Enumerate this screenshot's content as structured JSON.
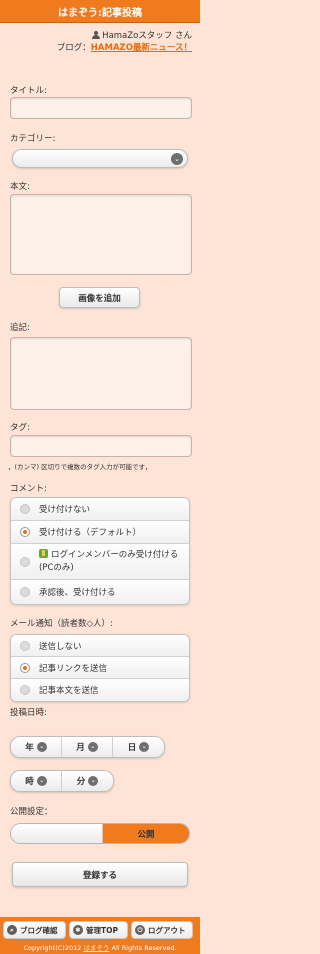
{
  "header": {
    "title": "はまぞう:記事投稿"
  },
  "user": {
    "name": "HamaZoスタッフ さん",
    "blog_prefix": "ブログ：",
    "blog_name": "HAMAZO最新ニュース！"
  },
  "form": {
    "title_label": "タイトル:",
    "category_label": "カテゴリー:",
    "body_label": "本文:",
    "add_image_label": "画像を追加",
    "addendum_label": "追記:",
    "tag_label": "タグ:",
    "tag_hint": "，(カンマ) 区切りで複数のタグ入力が可能です，",
    "comment_label": "コメント:",
    "comment_options": [
      {
        "label": "受け付けない",
        "selected": false
      },
      {
        "label": "受け付ける（デフォルト）",
        "selected": true
      },
      {
        "label": "ログインメンバーのみ受け付ける(PCのみ)",
        "selected": false
      },
      {
        "label": "承認後、受け付ける",
        "selected": false
      }
    ],
    "mail_label": "メール通知（読者数◇人）:",
    "mail_options": [
      {
        "label": "送信しない",
        "selected": false
      },
      {
        "label": "記事リンクを送信",
        "selected": true
      },
      {
        "label": "記事本文を送信",
        "selected": false
      }
    ],
    "date_label": "投稿日時:",
    "date_fields": [
      "年",
      "月",
      "日"
    ],
    "time_fields": [
      "時",
      "分"
    ],
    "publish_label": "公開設定：",
    "publish_value": "公開",
    "submit_label": "登録する"
  },
  "footer": {
    "buttons": [
      {
        "label": "ブログ確認",
        "icon": "search-icon"
      },
      {
        "label": "管理TOP",
        "icon": "gear-icon"
      },
      {
        "label": "ログアウト",
        "icon": "logout-icon"
      }
    ],
    "copyright_prefix": "Copyright(C)2012",
    "copyright_brand": "はまぞう",
    "copyright_suffix": "All Rights Reserved."
  },
  "colors": {
    "accent": "#f07a1e",
    "background": "#fde4d6",
    "link": "#e86a0c"
  }
}
